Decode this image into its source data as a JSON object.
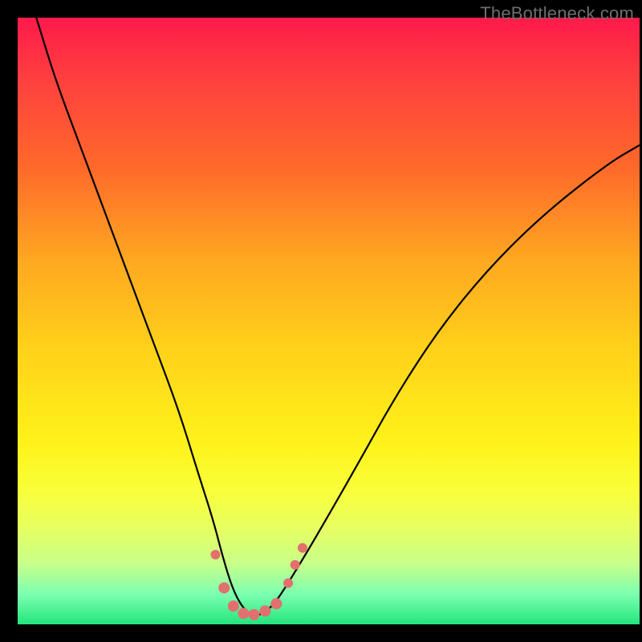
{
  "watermark": "TheBottleneck.com",
  "chart_data": {
    "type": "line",
    "title": "",
    "xlabel": "",
    "ylabel": "",
    "xlim": [
      0,
      100
    ],
    "ylim": [
      0,
      100
    ],
    "series": [
      {
        "name": "bottleneck-curve",
        "x": [
          3,
          6,
          10,
          14,
          18,
          22,
          26,
          29,
          31.5,
          33,
          34.5,
          36,
          37.5,
          39,
          41,
          43,
          46,
          50,
          55,
          61,
          68,
          76,
          85,
          95,
          100
        ],
        "y": [
          100,
          90,
          79,
          68,
          57,
          46,
          35,
          25,
          17,
          11,
          6,
          3,
          1.5,
          1.5,
          3,
          6,
          11,
          18,
          27,
          38,
          49,
          59,
          68,
          76,
          79
        ]
      }
    ],
    "markers": {
      "name": "highlight-points",
      "color": "#e2706e",
      "points": [
        {
          "x": 31.8,
          "y": 11.5,
          "r": 6
        },
        {
          "x": 33.2,
          "y": 6.0,
          "r": 7
        },
        {
          "x": 34.7,
          "y": 3.0,
          "r": 7
        },
        {
          "x": 36.3,
          "y": 1.8,
          "r": 7
        },
        {
          "x": 38.0,
          "y": 1.6,
          "r": 7
        },
        {
          "x": 39.8,
          "y": 2.2,
          "r": 7
        },
        {
          "x": 41.6,
          "y": 3.4,
          "r": 7
        },
        {
          "x": 43.5,
          "y": 6.8,
          "r": 6
        },
        {
          "x": 44.6,
          "y": 9.8,
          "r": 6
        },
        {
          "x": 45.8,
          "y": 12.6,
          "r": 6
        }
      ]
    },
    "gradient_stops": [
      {
        "pos": 0,
        "color": "#ff1a4b"
      },
      {
        "pos": 10,
        "color": "#ff3f3f"
      },
      {
        "pos": 25,
        "color": "#ff6a2a"
      },
      {
        "pos": 40,
        "color": "#ffa820"
      },
      {
        "pos": 55,
        "color": "#ffd21a"
      },
      {
        "pos": 70,
        "color": "#fff21a"
      },
      {
        "pos": 78,
        "color": "#f9ff3a"
      },
      {
        "pos": 84,
        "color": "#e8ff60"
      },
      {
        "pos": 90,
        "color": "#c8ff8a"
      },
      {
        "pos": 95,
        "color": "#7dffb0"
      },
      {
        "pos": 100,
        "color": "#23e57d"
      }
    ]
  }
}
